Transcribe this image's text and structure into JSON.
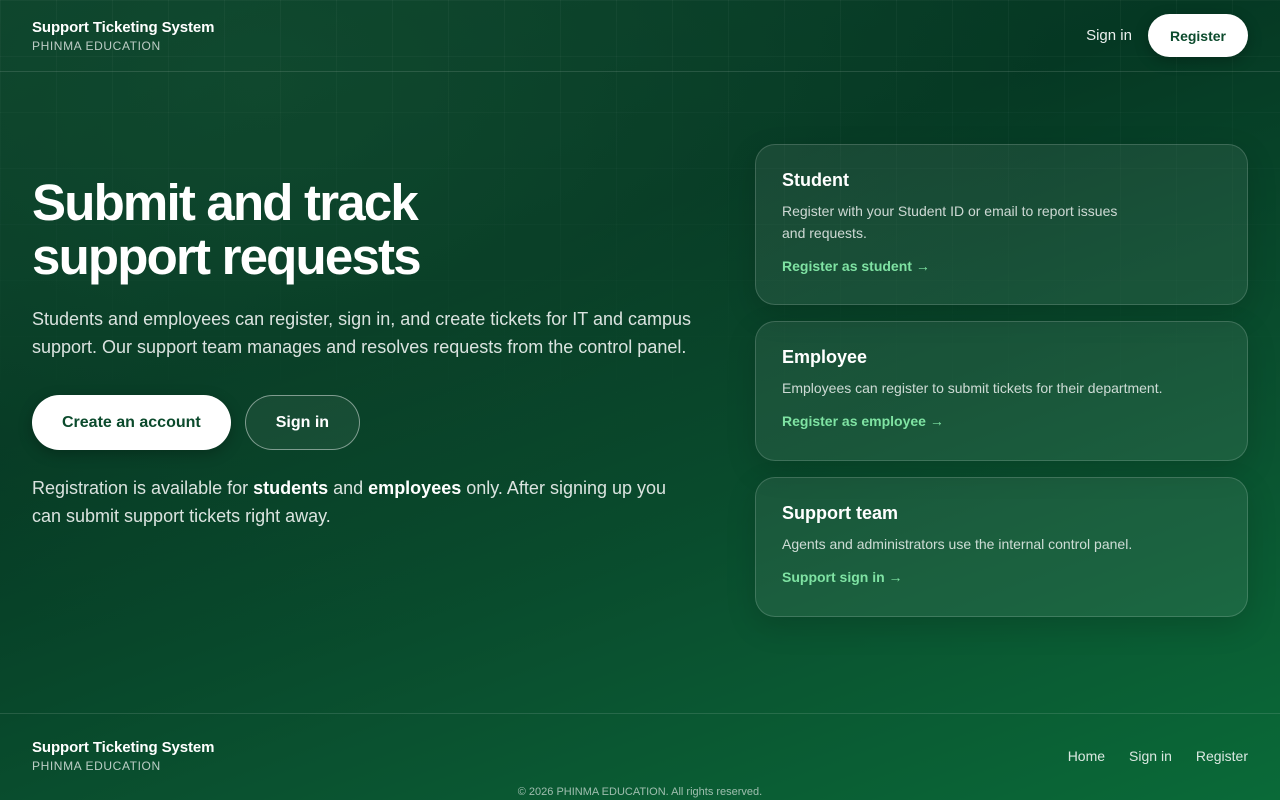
{
  "header": {
    "brand_title": "Support Ticketing System",
    "brand_subtitle": "PHINMA EDUCATION",
    "signin_label": "Sign in",
    "register_label": "Register"
  },
  "hero": {
    "title_line1": "Submit and track",
    "title_line2": "support requests",
    "lead": "Students and employees can register, sign in, and create tickets for IT and campus support. Our support team manages and resolves requests from the control panel.",
    "create_account_label": "Create an account",
    "signin_label": "Sign in",
    "note_prefix": "Registration is available for ",
    "note_students": "students",
    "note_and": " and ",
    "note_employees": "employees",
    "note_suffix": " only. After signing up you can submit support tickets right away."
  },
  "cards": [
    {
      "title": "Student",
      "description": "Register with your Student ID or email to report issues and requests.",
      "link": "Register as student →"
    },
    {
      "title": "Employee",
      "description": "Employees can register to submit tickets for their department.",
      "link": "Register as employee →"
    },
    {
      "title": "Support team",
      "description": "Agents and administrators use the internal control panel.",
      "link": "Support sign in →"
    }
  ],
  "footer": {
    "brand_title": "Support Ticketing System",
    "brand_subtitle": "PHINMA EDUCATION",
    "nav": [
      "Home",
      "Sign in",
      "Register"
    ],
    "copyright": "© 2026 PHINMA EDUCATION. All rights reserved."
  },
  "colors": {
    "accent_link": "#7fe3a3",
    "button_text": "#0b4a2c",
    "background_dark": "#053823"
  }
}
